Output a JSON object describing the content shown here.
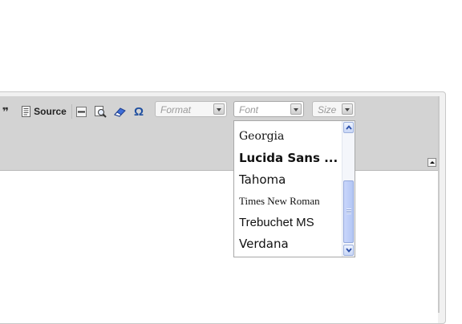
{
  "toolbar": {
    "source_label": "Source",
    "icons": [
      "blockquote-icon",
      "source-document-icon",
      "horizontal-rule-icon",
      "find-icon",
      "remove-format-icon",
      "special-char-icon"
    ],
    "special_char_glyph": "Ω",
    "blockquote_glyph": "❞"
  },
  "combos": {
    "format": {
      "label": "Format"
    },
    "font": {
      "label": "Font"
    },
    "size": {
      "label": "Size"
    }
  },
  "font_dropdown": {
    "items": [
      {
        "label": "Georgia"
      },
      {
        "label": "Lucida Sans ..."
      },
      {
        "label": "Tahoma"
      },
      {
        "label": "Times New Roman"
      },
      {
        "label": "Trebuchet MS"
      },
      {
        "label": "Verdana"
      }
    ],
    "scroll_position": 0.85
  },
  "colors": {
    "toolbar_bg": "#d3d3d3",
    "scrollbar_accent": "#b3c6f4"
  }
}
